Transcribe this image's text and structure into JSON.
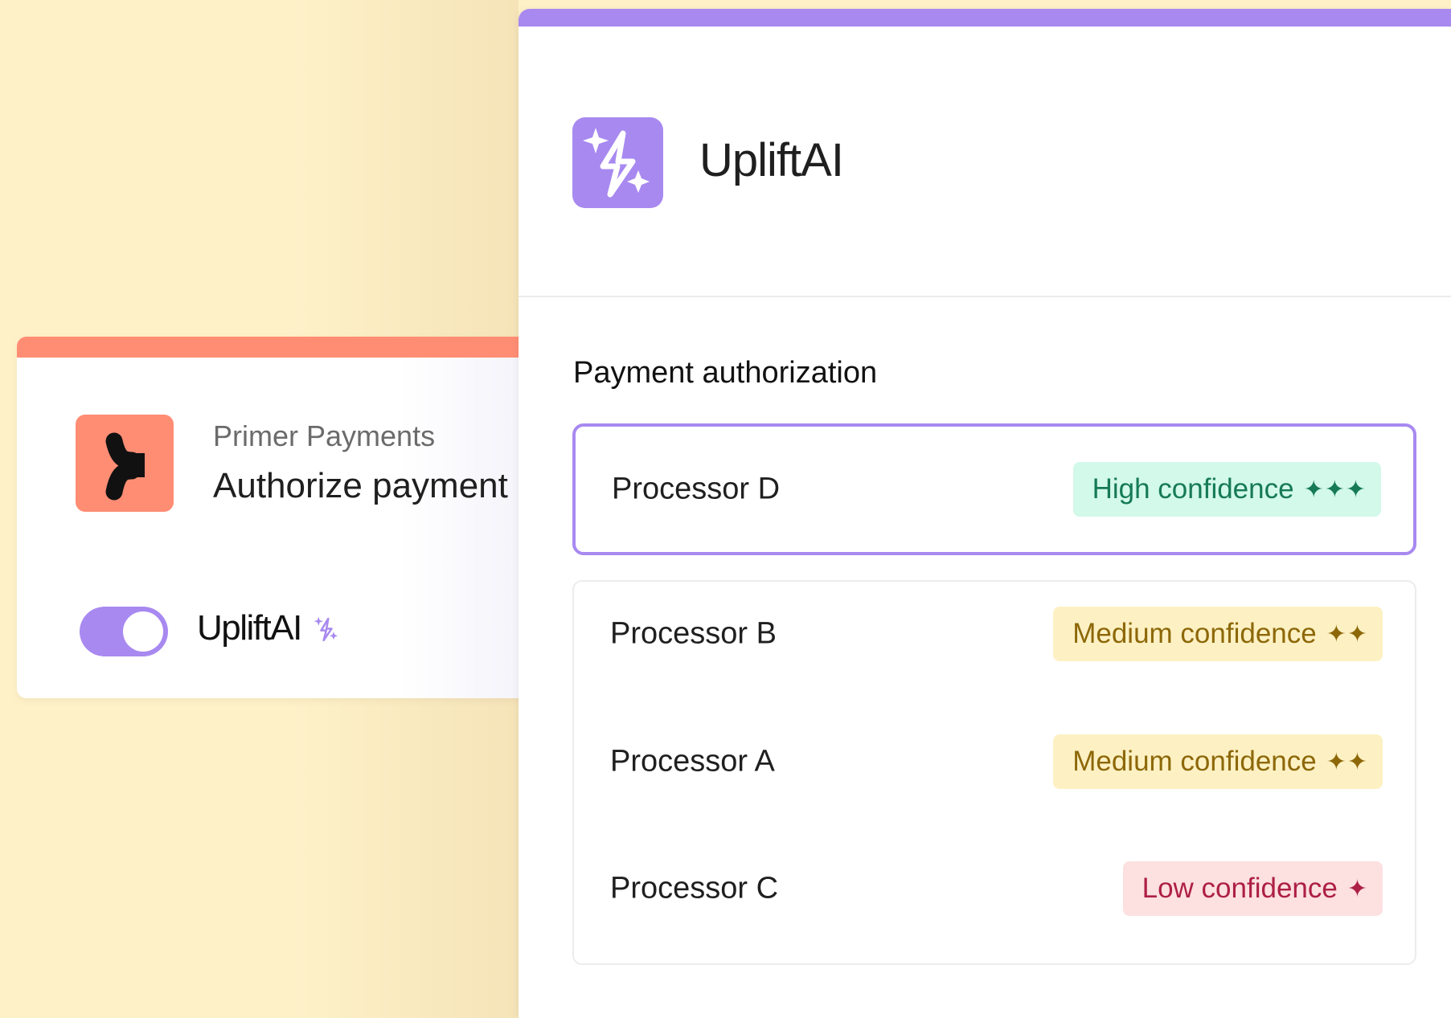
{
  "left_card": {
    "subtitle": "Primer Payments",
    "title": "Authorize payment",
    "toggle_on": true,
    "brand": "UpliftAI",
    "logo_icon": "primer-logo-icon",
    "brand_icon": "sparkle-bolt-icon"
  },
  "right_panel": {
    "title": "UpliftAI",
    "logo_icon": "sparkle-bolt-icon",
    "section_title": "Payment authorization",
    "selected": {
      "name": "Processor D",
      "confidence": "High confidence",
      "level": "high",
      "stars": "✦✦✦"
    },
    "processors": [
      {
        "name": "Processor B",
        "confidence": "Medium confidence",
        "level": "medium",
        "stars": "✦✦"
      },
      {
        "name": "Processor A",
        "confidence": "Medium confidence",
        "level": "medium",
        "stars": "✦✦"
      },
      {
        "name": "Processor C",
        "confidence": "Low confidence",
        "level": "low",
        "stars": "✦"
      }
    ]
  },
  "colors": {
    "background": "#fef1c8",
    "primer_accent": "#ff8d74",
    "uplift_accent": "#a889f0",
    "high_bg": "#d2f9e9",
    "high_fg": "#167a56",
    "medium_bg": "#fdf1c4",
    "medium_fg": "#8d6808",
    "low_bg": "#fde0e0",
    "low_fg": "#ad1f45"
  }
}
